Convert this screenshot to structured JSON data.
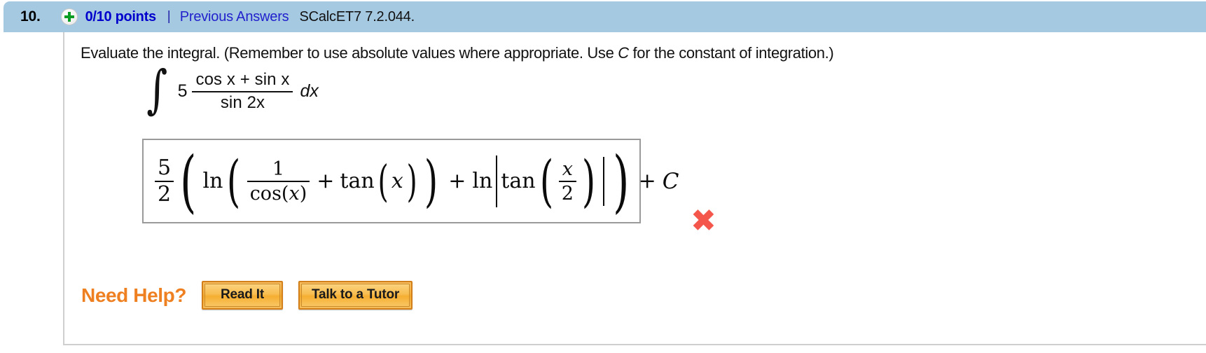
{
  "header": {
    "question_number": "10.",
    "status_icon": "plus-circle-icon",
    "points": "0/10 points",
    "separator": "|",
    "previous_answers_link": "Previous Answers",
    "reference_code": "SCalcET7 7.2.044.",
    "bar_color": "#a6c9e2",
    "points_color": "#0000cc",
    "link_color": "#2222cc"
  },
  "prompt": {
    "text_before_c": "Evaluate the integral. (Remember to use absolute values where appropriate. Use ",
    "italic_c": "C",
    "text_after_c": " for the constant of integration.)"
  },
  "integral": {
    "integral_sign": "∫",
    "coefficient": "5",
    "numerator": "cos x + sin x",
    "denominator": "sin 2x",
    "differential": "dx"
  },
  "answer": {
    "latex": "\\frac{5}{2}\\left(\\ln\\left(\\frac{1}{\\cos(x)}+\\tan(x)\\right)+\\ln\\left|\\tan\\left(\\frac{x}{2}\\right)\\right|\\right)+C",
    "outer_frac_num": "5",
    "outer_frac_den": "2",
    "ln_1": "ln",
    "inner_frac_num": "1",
    "inner_frac_den_op": "cos",
    "inner_frac_den_arg": "x",
    "plus_1": "+",
    "tan_1_op": "tan",
    "tan_1_arg": "x",
    "plus_2": "+",
    "ln_2": "ln",
    "tan_2_op": "tan",
    "tan_2_frac_num": "x",
    "tan_2_frac_den": "2",
    "plus_3": "+",
    "constant": "C",
    "correctness_mark": "✖",
    "correctness_color": "#f4564c",
    "is_correct": false,
    "box_border_color": "#9a9a9a"
  },
  "help": {
    "label": "Need Help?",
    "label_color": "#ef8021",
    "buttons": [
      {
        "name": "read-it",
        "label": "Read It"
      },
      {
        "name": "talk-to-a-tutor",
        "label": "Talk to a Tutor"
      }
    ]
  }
}
